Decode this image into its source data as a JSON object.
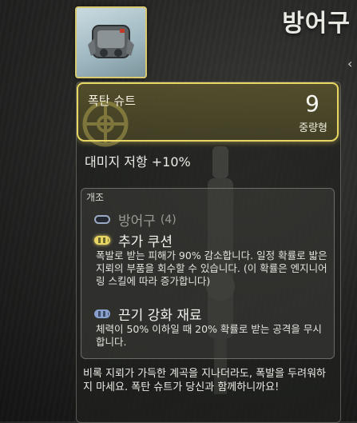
{
  "page": {
    "title": "방어구"
  },
  "item": {
    "name": "폭탄 슈트",
    "rank": "9",
    "weight_class": "중량형",
    "stat": "대미지 저항 +10%"
  },
  "mods": {
    "title": "개조",
    "armor_slot": {
      "label": "방어구",
      "count": "(4)"
    },
    "list": [
      {
        "name": "추가 쿠션",
        "slot_color": "#e7d663",
        "description": "폭발로 받는 피해가 90% 감소합니다. 일정 확률로 밟은 지뢰의 부품을 회수할 수 있습니다. (이 확률은 엔지니어링 스킬에 따라 증가합니다)"
      },
      {
        "name": "끈기 강화 재료",
        "slot_color": "#8aa0cc",
        "description": "체력이 50% 이하일 때 20% 확률로 받는 공격을 무시합니다."
      }
    ]
  },
  "flavor": "비록 지뢰가 가득한 계곡을 지나더라도, 폭발을 두려워하지 마세요. 폭탄 슈트가 당신과 함께하니까요!",
  "colors": {
    "highlight": "#e7d663",
    "slot_empty": "#9aa9c6"
  }
}
